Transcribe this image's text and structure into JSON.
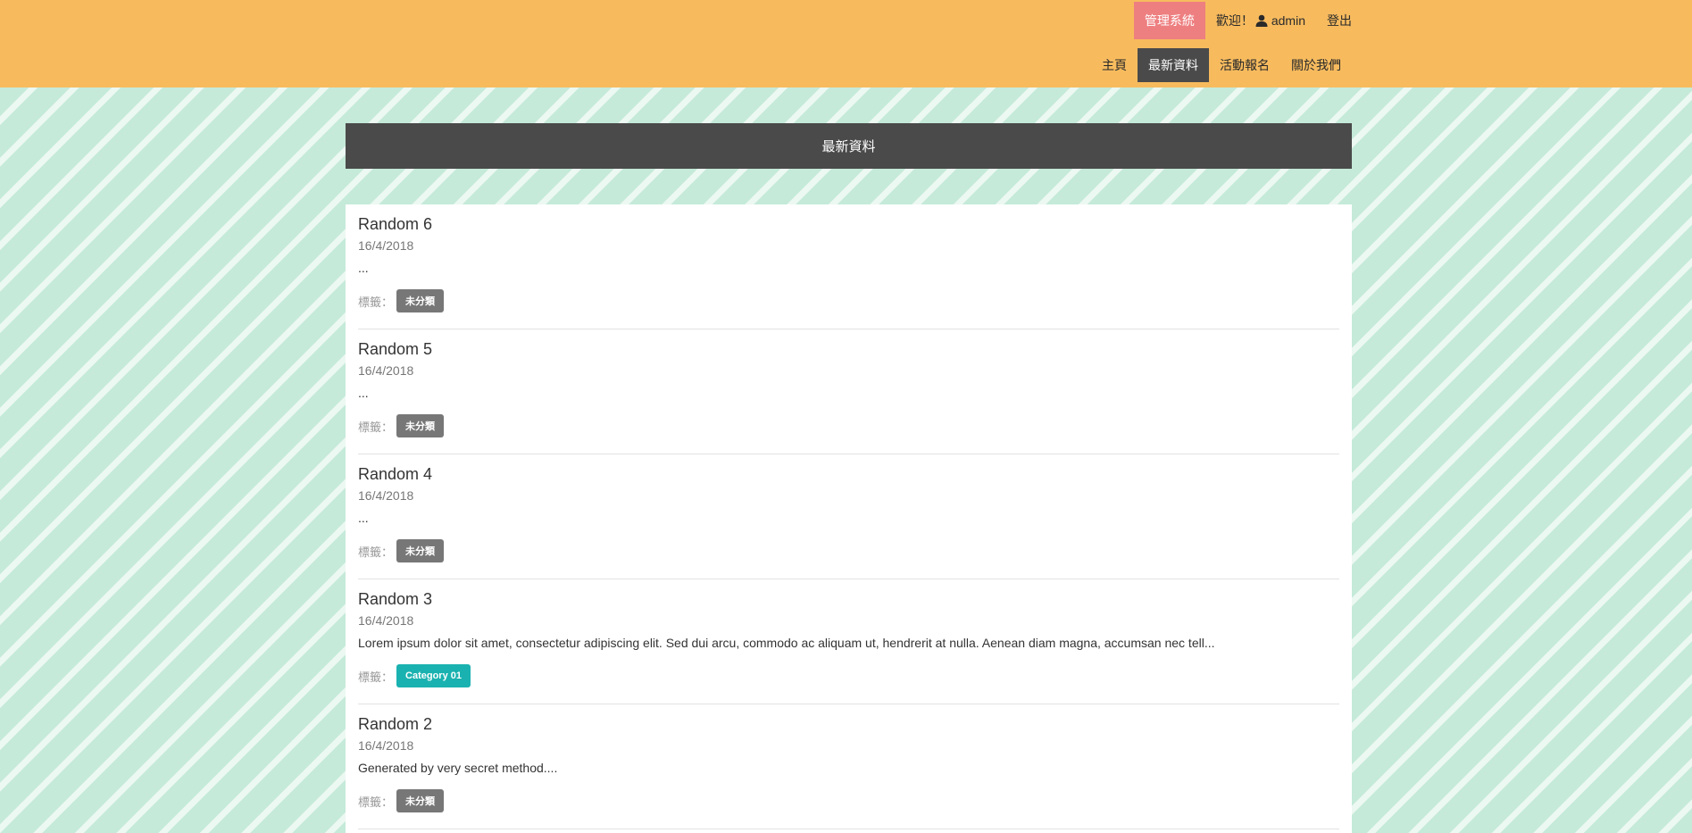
{
  "header": {
    "admin_label": "管理系統",
    "welcome_label": "歡迎！",
    "username": "admin",
    "logout_label": "登出",
    "nav": [
      {
        "label": "主頁",
        "active": false
      },
      {
        "label": "最新資料",
        "active": true
      },
      {
        "label": "活動報名",
        "active": false
      },
      {
        "label": "關於我們",
        "active": false
      }
    ]
  },
  "page_title": "最新資料",
  "tags_label": "標籤：",
  "posts": [
    {
      "title": "Random 6",
      "date": "16/4/2018",
      "excerpt": "...",
      "tag": "未分類",
      "tag_color": "#777777"
    },
    {
      "title": "Random 5",
      "date": "16/4/2018",
      "excerpt": "...",
      "tag": "未分類",
      "tag_color": "#777777"
    },
    {
      "title": "Random 4",
      "date": "16/4/2018",
      "excerpt": "...",
      "tag": "未分類",
      "tag_color": "#777777"
    },
    {
      "title": "Random 3",
      "date": "16/4/2018",
      "excerpt": "Lorem ipsum dolor sit amet, consectetur adipiscing elit. Sed dui arcu, commodo ac aliquam ut, hendrerit at nulla. Aenean diam magna, accumsan nec tell...",
      "tag": "Category 01",
      "tag_color": "#1ab2b0"
    },
    {
      "title": "Random 2",
      "date": "16/4/2018",
      "excerpt": "Generated by very secret method....",
      "tag": "未分類",
      "tag_color": "#777777"
    }
  ],
  "colors": {
    "header_bg": "#f7bb5e",
    "admin_button_bg": "#ee7f80",
    "nav_active_bg": "#4a4a4a",
    "page_bg": "#c5ead9",
    "stripe": "#ecf8f2"
  },
  "icons": {
    "user": "user-icon"
  }
}
